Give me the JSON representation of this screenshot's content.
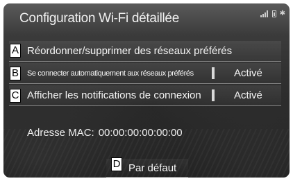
{
  "header": {
    "title": "Configuration Wi-Fi détaillée"
  },
  "status_icons": [
    "signal-icon",
    "battery-icon",
    "bluetooth-icon"
  ],
  "settings": [
    {
      "callout": "A",
      "label": "Réordonner/supprimer des réseaux préférés"
    },
    {
      "callout": "B",
      "label": "Se connecter automatiquement aux réseaux préférés",
      "value": "Activé"
    },
    {
      "callout": "C",
      "label": "Afficher les notifications de connexion",
      "value": "Activé"
    }
  ],
  "mac": {
    "label": "Adresse MAC:",
    "value": "00:00:00:00:00:00"
  },
  "default_button": {
    "callout": "D",
    "label": "Par défaut"
  }
}
